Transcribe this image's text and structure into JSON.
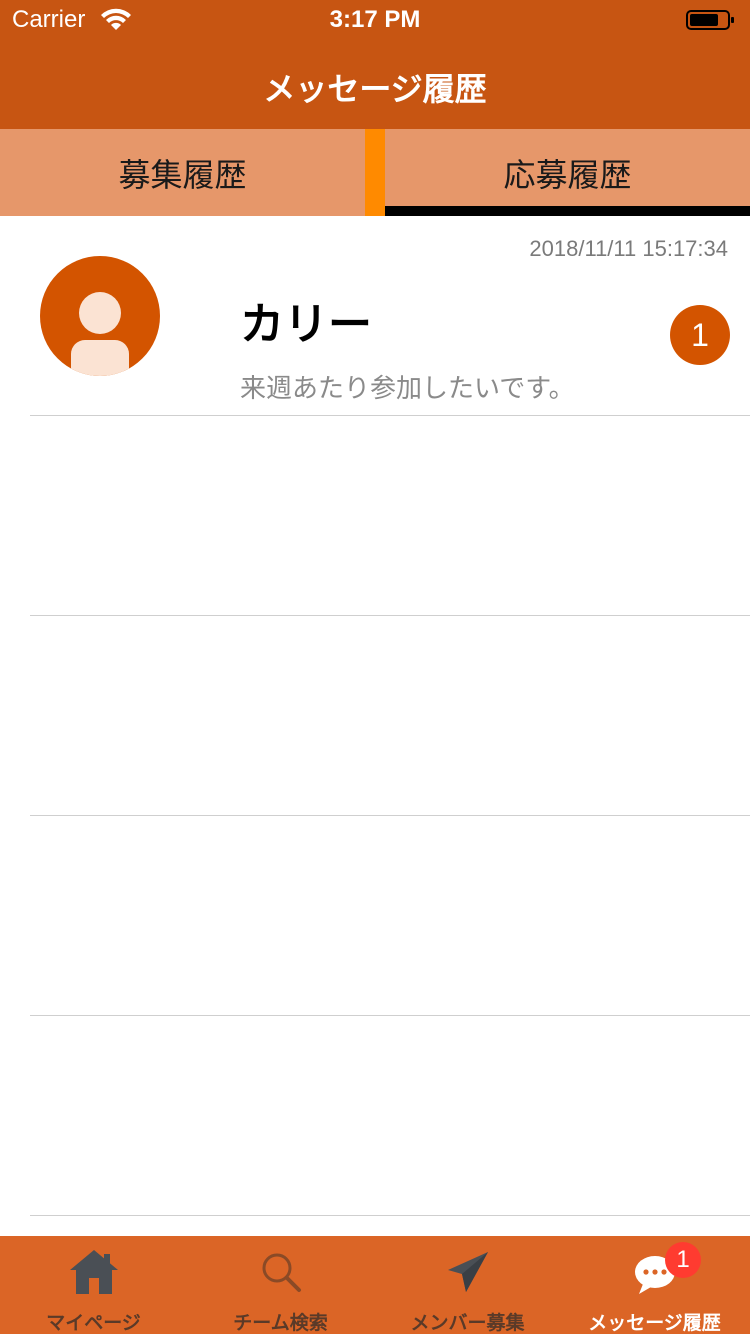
{
  "status_bar": {
    "carrier": "Carrier",
    "time": "3:17 PM",
    "wifi_icon": "wifi-icon",
    "battery_icon": "battery-icon"
  },
  "header": {
    "title": "メッセージ履歴"
  },
  "segments": {
    "left_label": "募集履歴",
    "right_label": "応募履歴",
    "selected": "応募履歴",
    "divider_color": "#ff8a00",
    "indicator_color": "#000000"
  },
  "messages": [
    {
      "timestamp": "2018/11/11 15:17:34",
      "name": "カリー",
      "preview": "来週あたり参加したいです。",
      "unread_count": "1",
      "avatar_icon": "user-avatar-icon"
    }
  ],
  "tabbar": {
    "items": [
      {
        "label": "マイページ",
        "icon": "home-icon"
      },
      {
        "label": "チーム検索",
        "icon": "search-icon"
      },
      {
        "label": "メンバー募集",
        "icon": "paper-plane-icon"
      },
      {
        "label": "メッセージ履歴",
        "icon": "chat-bubble-icon",
        "badge": "1"
      }
    ],
    "active": "メッセージ履歴"
  },
  "colors": {
    "nav_bar": "#c75512",
    "segment_bg": "#e6976a",
    "accent": "#d35400",
    "tab_bar": "#db6526",
    "badge_red": "#ff3b30"
  }
}
